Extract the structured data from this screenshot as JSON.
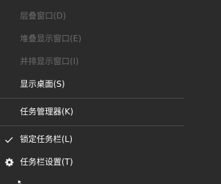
{
  "menu": {
    "items": [
      {
        "label": "层叠窗口(D)",
        "disabled": true
      },
      {
        "label": "堆叠显示窗口(E)",
        "disabled": true
      },
      {
        "label": "并排显示窗口(I)",
        "disabled": true
      },
      {
        "label": "显示桌面(S)",
        "disabled": false
      },
      {
        "label": "任务管理器(K)",
        "disabled": false
      },
      {
        "label": "锁定任务栏(L)",
        "disabled": false,
        "checked": true,
        "icon": "checkmark-icon"
      },
      {
        "label": "任务栏设置(T)",
        "disabled": false,
        "icon": "gear-icon"
      }
    ]
  },
  "colors": {
    "background": "#2b2b2b",
    "text": "#ffffff",
    "disabled_text": "#6d6d6d",
    "separator": "#4a4a4a"
  }
}
